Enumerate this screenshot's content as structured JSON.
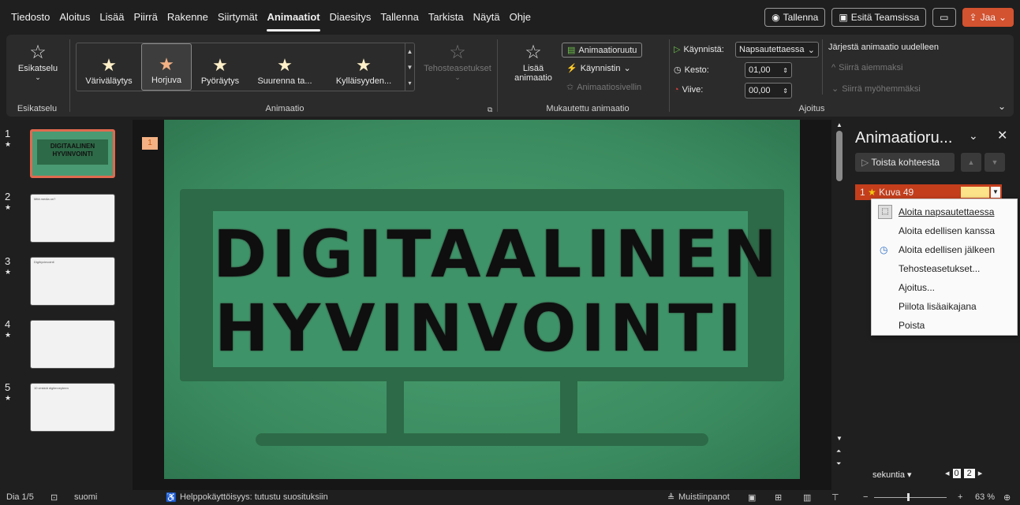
{
  "menu": {
    "tabs": [
      "Tiedosto",
      "Aloitus",
      "Lisää",
      "Piirrä",
      "Rakenne",
      "Siirtymät",
      "Animaatiot",
      "Diaesitys",
      "Tallenna",
      "Tarkista",
      "Näytä",
      "Ohje"
    ],
    "active": "Animaatiot",
    "record_label": "Tallenna",
    "teams_label": "Esitä Teamsissa",
    "share_label": "Jaa"
  },
  "ribbon": {
    "preview": {
      "button_label": "Esikatselu",
      "group_label": "Esikatselu"
    },
    "animation": {
      "items": [
        "Väriväläytys",
        "Horjuva",
        "Pyöräytys",
        "Suurenna ta...",
        "Kylläisyyden..."
      ],
      "selected": "Horjuva",
      "effect_options": "Tehosteasetukset",
      "group_label": "Animaatio"
    },
    "custom": {
      "add_label_1": "Lisää",
      "add_label_2": "animaatio",
      "pane_label": "Animaatioruutu",
      "trigger_label": "Käynnistin",
      "painter_label": "Animaatiosivellin",
      "group_label": "Mukautettu animaatio"
    },
    "timing": {
      "start_label": "Käynnistä:",
      "start_value": "Napsautettaessa",
      "duration_label": "Kesto:",
      "duration_value": "01,00",
      "delay_label": "Viive:",
      "delay_value": "00,00",
      "group_label": "Ajoitus"
    },
    "reorder": {
      "title": "Järjestä animaatio uudelleen",
      "earlier": "Siirrä aiemmaksi",
      "later": "Siirrä myöhemmäksi"
    }
  },
  "slides": [
    {
      "num": "1",
      "star": "★",
      "title": "DIGITAALINEN HYVINVOINTI"
    },
    {
      "num": "2",
      "star": "★",
      "title": "Mitä media on?"
    },
    {
      "num": "3",
      "star": "★",
      "title": "Digihyvinvointi"
    },
    {
      "num": "4",
      "star": "★",
      "title": ""
    },
    {
      "num": "5",
      "star": "★",
      "title": "10 vinkkiä digiterveyteen"
    }
  ],
  "canvas": {
    "marker": "1",
    "line1": "DIGITAALINEN",
    "line2": "HYVINVOINTI"
  },
  "anim_pane": {
    "title": "Animaatioru...",
    "play_from": "Toista kohteesta",
    "item_number": "1",
    "item_name": "Kuva 49",
    "seconds_label": "sekuntia",
    "timeline_start": "0",
    "timeline_next": "2"
  },
  "context_menu": [
    "Aloita napsautettaessa",
    "Aloita edellisen kanssa",
    "Aloita edellisen jälkeen",
    "Tehosteasetukset...",
    "Ajoitus...",
    "Piilota lisäaikajana",
    "Poista"
  ],
  "status": {
    "slide": "Dia 1/5",
    "language": "suomi",
    "accessibility": "Helppokäyttöisyys: tutustu suosituksiin",
    "notes": "Muistiinpanot",
    "zoom": "63 %"
  },
  "colors": {
    "accent": "#d35230",
    "slide_bg": "#3e9468",
    "ribbon_bg": "#2b2b2b"
  }
}
